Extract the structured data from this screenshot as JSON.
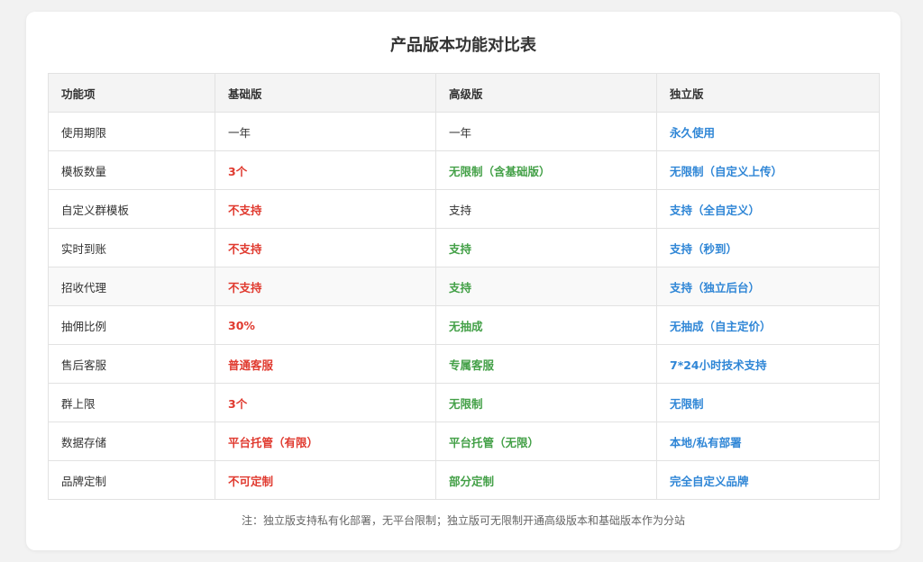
{
  "title": "产品版本功能对比表",
  "headers": [
    "功能项",
    "基础版",
    "高级版",
    "独立版"
  ],
  "rows": [
    {
      "feature": "使用期限",
      "basic": {
        "text": "一年",
        "style": "plain"
      },
      "advanced": {
        "text": "一年",
        "style": "plain"
      },
      "independent": {
        "text": "永久使用",
        "style": "blue"
      }
    },
    {
      "feature": "模板数量",
      "basic": {
        "text": "3个",
        "style": "red"
      },
      "advanced": {
        "text": "无限制（含基础版）",
        "style": "green"
      },
      "independent": {
        "text": "无限制（自定义上传）",
        "style": "blue"
      }
    },
    {
      "feature": "自定义群模板",
      "basic": {
        "text": "不支持",
        "style": "red"
      },
      "advanced": {
        "text": "支持",
        "style": "plain"
      },
      "independent": {
        "text": "支持（全自定义）",
        "style": "blue"
      }
    },
    {
      "feature": "实时到账",
      "basic": {
        "text": "不支持",
        "style": "red"
      },
      "advanced": {
        "text": "支持",
        "style": "green"
      },
      "independent": {
        "text": "支持（秒到）",
        "style": "blue"
      }
    },
    {
      "feature": "招收代理",
      "basic": {
        "text": "不支持",
        "style": "red"
      },
      "advanced": {
        "text": "支持",
        "style": "green"
      },
      "independent": {
        "text": "支持（独立后台）",
        "style": "blue"
      }
    },
    {
      "feature": "抽佣比例",
      "basic": {
        "text": "30%",
        "style": "red"
      },
      "advanced": {
        "text": "无抽成",
        "style": "green"
      },
      "independent": {
        "text": "无抽成（自主定价）",
        "style": "blue"
      }
    },
    {
      "feature": "售后客服",
      "basic": {
        "text": "普通客服",
        "style": "red"
      },
      "advanced": {
        "text": "专属客服",
        "style": "green"
      },
      "independent": {
        "text": "7*24小时技术支持",
        "style": "blue"
      }
    },
    {
      "feature": "群上限",
      "basic": {
        "text": "3个",
        "style": "red"
      },
      "advanced": {
        "text": "无限制",
        "style": "green"
      },
      "independent": {
        "text": "无限制",
        "style": "blue"
      }
    },
    {
      "feature": "数据存储",
      "basic": {
        "text": "平台托管（有限）",
        "style": "red"
      },
      "advanced": {
        "text": "平台托管（无限）",
        "style": "green"
      },
      "independent": {
        "text": "本地/私有部署",
        "style": "blue"
      }
    },
    {
      "feature": "品牌定制",
      "basic": {
        "text": "不可定制",
        "style": "red"
      },
      "advanced": {
        "text": "部分定制",
        "style": "green"
      },
      "independent": {
        "text": "完全自定义品牌",
        "style": "blue"
      }
    }
  ],
  "note": "注：独立版支持私有化部署，无平台限制；独立版可无限制开通高级版本和基础版本作为分站",
  "colors": {
    "red": "#e03a2f",
    "green": "#43a047",
    "blue": "#2f86d6"
  }
}
